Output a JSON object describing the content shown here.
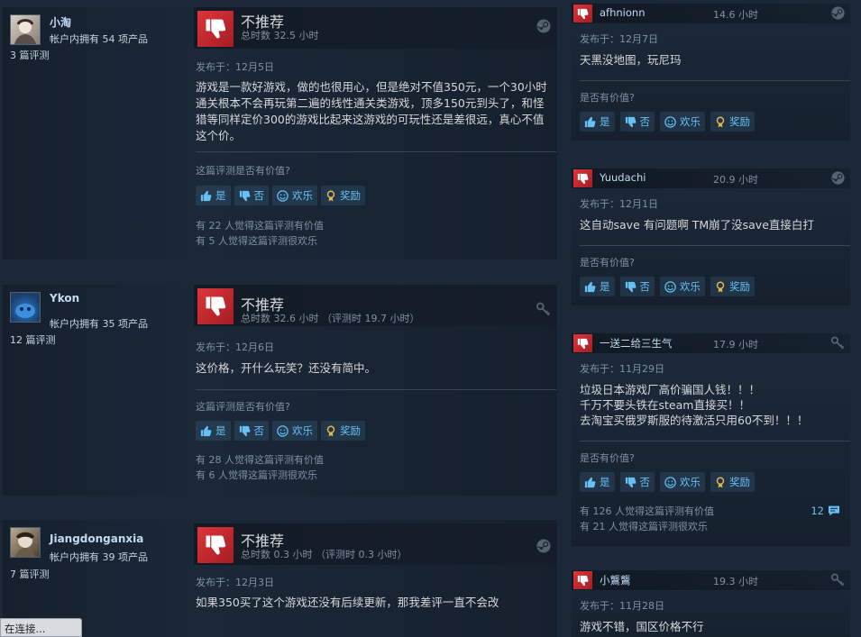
{
  "labels": {
    "not_recommended": "不推荐",
    "helpful_q": "这篇评测是否有价值?",
    "helpful_q_short": "是否有价值?",
    "yes": "是",
    "no": "否",
    "funny": "欢乐",
    "award": "奖励"
  },
  "colors": {
    "background": "#1b2838",
    "accent": "#66c0f4",
    "thumb_down": "#c2262e",
    "award": "#e5b84b"
  },
  "reviews": [
    {
      "author": "小淘",
      "products": "帐户内拥有 54 项产品",
      "review_count": "3 篇评测",
      "hours": "总时数 32.5 小时",
      "posted": "发布于：12月5日",
      "content": "游戏是一款好游戏，做的也很用心，但是绝对不值350元，一个30小时通关根本不会再玩第二遍的线性通关类游戏，顶多150元到头了，和怪猎等同样定价300的游戏比起来这游戏的可玩性还是差很远，真心不值这个价。",
      "helpful": "有 22 人觉得这篇评测有价值",
      "funny": "有 5 人觉得这篇评测很欢乐",
      "icon": "steam-icon"
    },
    {
      "author": "Ykon",
      "products": "帐户内拥有 35 项产品",
      "review_count": "12 篇评测",
      "hours": "总时数 32.6 小时 （评测时 19.7 小时）",
      "posted": "发布于：12月6日",
      "content": "这价格，开什么玩笑？还没有简中。",
      "helpful": "有 28 人觉得这篇评测有价值",
      "funny": "有 6 人觉得这篇评测很欢乐",
      "icon": "key-icon"
    },
    {
      "author": "Jiangdonganxia",
      "products": "帐户内拥有 39 项产品",
      "review_count": "7 篇评测",
      "hours": "总时数 0.3 小时 （评测时 0.3 小时）",
      "posted": "发布于：12月3日",
      "content": "如果350买了这个游戏还没有后续更新，那我差评一直不会改",
      "icon": "steam-icon"
    }
  ],
  "side_reviews": [
    {
      "author": "afhnionn",
      "hours": "14.6 小时",
      "posted": "发布于：12月7日",
      "content": "天黑没地图，玩尼玛",
      "icon": "steam-icon"
    },
    {
      "author": "Yuudachi",
      "hours": "20.9 小时",
      "posted": "发布于：12月1日",
      "content": "这自动save 有问题啊 TM崩了没save直接白打",
      "icon": "steam-icon"
    },
    {
      "author": "一送二给三生气",
      "hours": "17.9 小时",
      "posted": "发布于：11月29日",
      "content": "垃圾日本游戏厂高价骗国人钱！！！\n千万不要头铁在steam直接买！！\n去淘宝买俄罗斯服的待激活只用60不到！！！",
      "helpful": "有 126 人觉得这篇评测有价值",
      "funny": "有 21 人觉得这篇评测很欢乐",
      "comments": "12",
      "icon": "key-icon"
    },
    {
      "author": "小鸗鸗",
      "hours": "19.3 小时",
      "posted": "发布于：11月28日",
      "content": "游戏不错，国区价格不行",
      "icon": "key-icon"
    }
  ],
  "status": {
    "text": "在连接..."
  }
}
